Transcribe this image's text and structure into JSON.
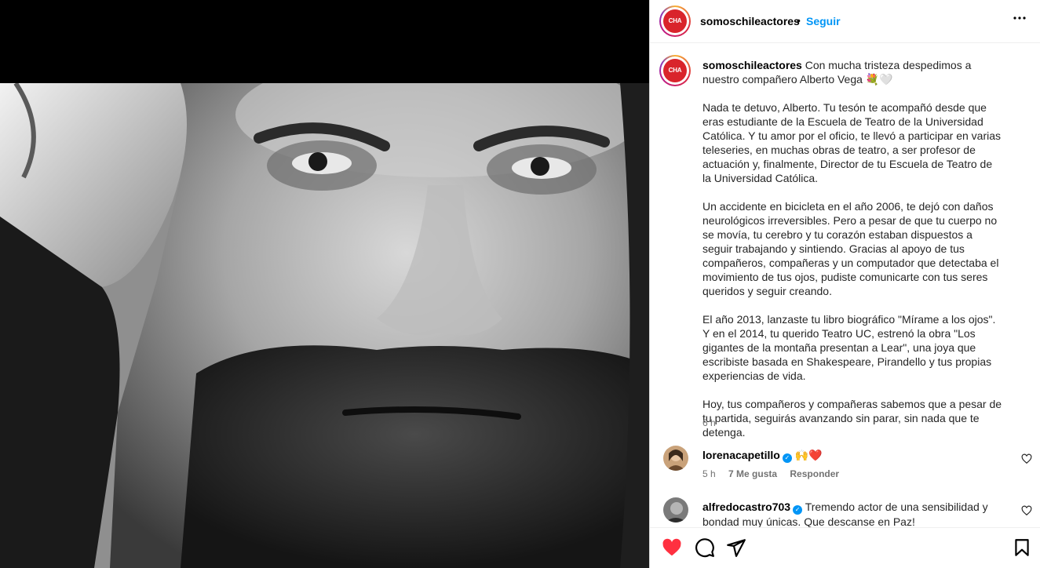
{
  "post": {
    "username": "somoschileactores",
    "follow_label": "Seguir",
    "separator": "•",
    "avatar_text": "CHA",
    "more_label": "•••"
  },
  "caption": {
    "username": "somoschileactores",
    "intro": "Con mucha tristeza despedimos a nuestro compañero Alberto Vega",
    "intro_emoji": "💐🤍",
    "paragraphs": [
      "Nada te detuvo, Alberto. Tu tesón te acompañó desde que eras estudiante de la Escuela de Teatro de la Universidad Católica. Y tu amor por el oficio, te llevó a participar en varias teleseries, en muchas obras de teatro, a ser profesor de actuación y, finalmente, Director de tu Escuela de Teatro de la Universidad Católica.",
      "Un accidente en bicicleta en el año 2006, te dejó con daños neurológicos irreversibles. Pero a pesar de que tu cuerpo no se movía, tu cerebro y tu corazón estaban dispuestos a seguir trabajando y sintiendo. Gracias al apoyo de tus compañeros, compañeras y un computador que detectaba el movimiento de tus ojos, pudiste comunicarte con tus seres queridos y seguir creando.",
      "El año 2013, lanzaste tu libro biográfico \"Mírame a los ojos\". Y en el 2014, tu querido Teatro UC, estrenó la obra \"Los gigantes de la montaña presentan a Lear\", una joya que escribiste basada en Shakespeare, Pirandello y tus propias experiencias de vida.",
      "Hoy, tus compañeros y compañeras sabemos que a pesar de tu partida, seguirás avanzando sin parar, sin nada que te detenga."
    ],
    "time": "6 h"
  },
  "comments": [
    {
      "username": "lorenacapetillo",
      "verified_icon": "✓",
      "text": "🙌❤️",
      "time": "5 h",
      "likes": "7 Me gusta",
      "reply": "Responder"
    },
    {
      "username": "alfredocastro703",
      "verified_icon": "✓",
      "text": "Tremendo actor de una sensibilidad y bondad muy únicas. Que descanse en Paz!",
      "time": "",
      "likes": "",
      "reply": ""
    }
  ],
  "actions": {
    "like_icon": "heart-filled-icon",
    "comment_icon": "comment-icon",
    "share_icon": "send-icon",
    "save_icon": "bookmark-icon",
    "like_color": "#ff3040"
  },
  "colors": {
    "accent": "#0095f6",
    "brand_logo": "#d9242b"
  }
}
